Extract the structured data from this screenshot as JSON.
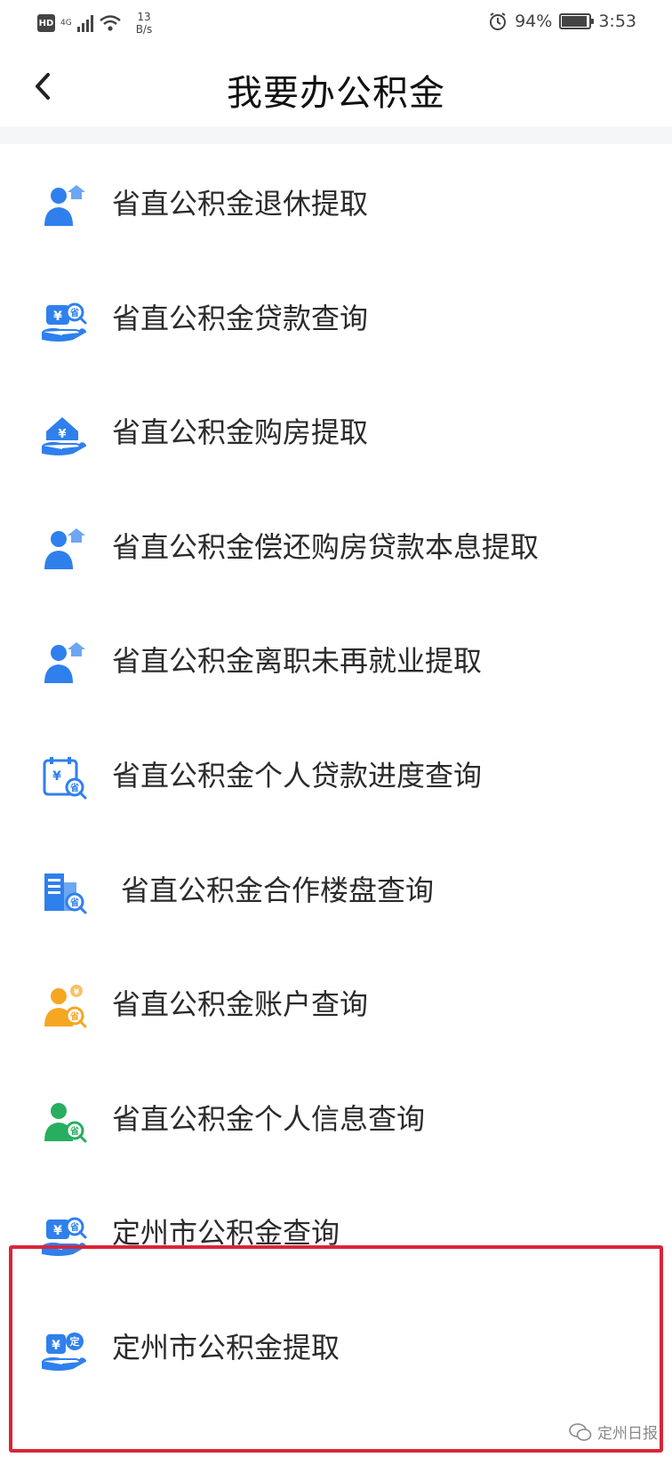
{
  "status_bar": {
    "hd": "HD",
    "network": "4G",
    "speed_value": "13",
    "speed_unit": "B/s",
    "battery": "94%",
    "time": "3:53",
    "battery_level": 0.94
  },
  "header": {
    "title": "我要办公积金"
  },
  "items": [
    {
      "label": "省直公积金退休提取",
      "icon": "person-upload-icon",
      "color": "#2f80ed"
    },
    {
      "label": "省直公积金贷款查询",
      "icon": "yuan-hand-search-icon",
      "color": "#2f80ed"
    },
    {
      "label": "省直公积金购房提取",
      "icon": "house-yuan-icon",
      "color": "#2f80ed"
    },
    {
      "label": "省直公积金偿还购房贷款本息提取",
      "icon": "person-upload-icon",
      "color": "#2f80ed"
    },
    {
      "label": "省直公积金离职未再就业提取",
      "icon": "person-upload-icon",
      "color": "#2f80ed"
    },
    {
      "label": "省直公积金个人贷款进度查询",
      "icon": "calendar-yuan-search-icon",
      "color": "#2f80ed"
    },
    {
      "label": "省直公积金合作楼盘查询",
      "icon": "building-search-icon",
      "color": "#2f80ed"
    },
    {
      "label": "省直公积金账户查询",
      "icon": "person-yuan-search-icon",
      "color": "#f5a623"
    },
    {
      "label": "省直公积金个人信息查询",
      "icon": "person-search-icon",
      "color": "#27ae60"
    },
    {
      "label": "定州市公积金查询",
      "icon": "yuan-hand-search-icon",
      "color": "#2f80ed"
    },
    {
      "label": "定州市公积金提取",
      "icon": "yuan-hand-ding-icon",
      "color": "#2f80ed"
    }
  ],
  "icon_badges": {
    "sheng": "省",
    "ding": "定",
    "yuan": "¥"
  },
  "watermark": "定州日报",
  "colors": {
    "highlight_border": "#d9253a",
    "primary_blue": "#2f80ed"
  }
}
